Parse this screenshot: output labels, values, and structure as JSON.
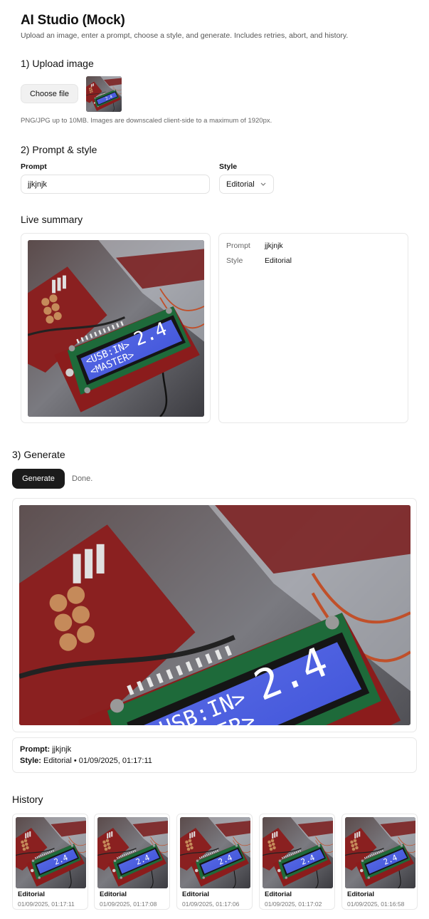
{
  "app": {
    "title": "AI Studio (Mock)",
    "subtitle": "Upload an image, enter a prompt, choose a style, and generate. Includes retries, abort, and history."
  },
  "upload": {
    "heading": "1) Upload image",
    "button_label": "Choose file",
    "hint": "PNG/JPG up to 10MB. Images are downscaled client-side to a maximum of 1920px."
  },
  "prompt_section": {
    "heading": "2) Prompt & style",
    "prompt_label": "Prompt",
    "prompt_value": "jjkjnjk",
    "style_label": "Style",
    "style_value": "Editorial"
  },
  "summary": {
    "heading": "Live summary",
    "prompt_key": "Prompt",
    "prompt_value": "jjkjnjk",
    "style_key": "Style",
    "style_value": "Editorial"
  },
  "generate": {
    "heading": "3) Generate",
    "button_label": "Generate",
    "status": "Done.",
    "result_prompt_label": "Prompt:",
    "result_prompt_value": "jjkjnjk",
    "result_style_label": "Style:",
    "result_style_value": "Editorial • 01/09/2025, 01:17:11"
  },
  "lcd": {
    "line1": "<USB:IN>",
    "line2": "<MASTER>",
    "big": "2.4"
  },
  "history": {
    "heading": "History",
    "items": [
      {
        "style": "Editorial",
        "time": "01/09/2025, 01:17:11"
      },
      {
        "style": "Editorial",
        "time": "01/09/2025, 01:17:08"
      },
      {
        "style": "Editorial",
        "time": "01/09/2025, 01:17:06"
      },
      {
        "style": "Editorial",
        "time": "01/09/2025, 01:17:02"
      },
      {
        "style": "Editorial",
        "time": "01/09/2025, 01:16:58"
      }
    ]
  },
  "icons": {
    "select_chevron": "chevron-down-icon"
  }
}
